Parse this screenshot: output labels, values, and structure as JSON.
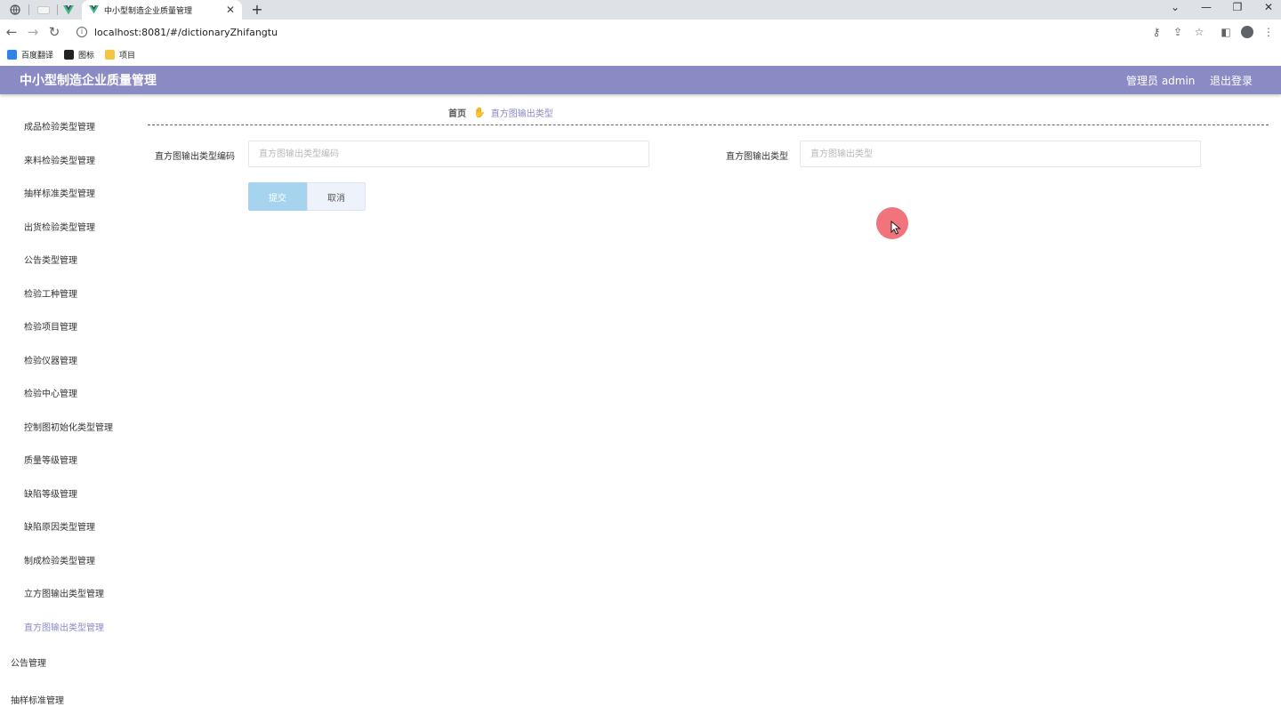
{
  "browser": {
    "tab_title": "中小型制造企业质量管理",
    "new_tab": "+",
    "url": "localhost:8081/#/dictionaryZhifangtu",
    "bookmarks": [
      "百度翻译",
      "图标",
      "项目"
    ],
    "window_controls": [
      "⌄",
      "—",
      "❐",
      "✕"
    ]
  },
  "header": {
    "title": "中小型制造企业质量管理",
    "user": "管理员 admin",
    "logout": "退出登录",
    "color": "#8a8ac4"
  },
  "sidebar": {
    "items": [
      "成品检验类型管理",
      "来料检验类型管理",
      "抽样标准类型管理",
      "出货检验类型管理",
      "公告类型管理",
      "检验工种管理",
      "检验项目管理",
      "检验仪器管理",
      "检验中心管理",
      "控制图初始化类型管理",
      "质量等级管理",
      "缺陷等级管理",
      "缺陷原因类型管理",
      "制成检验类型管理",
      "立方图输出类型管理",
      "直方图输出类型管理"
    ],
    "active_index": 15,
    "groups": [
      "公告管理",
      "抽样标准管理"
    ]
  },
  "breadcrumb": {
    "home": "首页",
    "separator_icon": "hand-icon",
    "current": "直方图输出类型"
  },
  "form": {
    "code_label": "直方图输出类型编码",
    "code_placeholder": "直方图输出类型编码",
    "code_value": "",
    "type_label": "直方图输出类型",
    "type_placeholder": "直方图输出类型",
    "type_value": "",
    "submit": "提交",
    "cancel": "取消"
  }
}
